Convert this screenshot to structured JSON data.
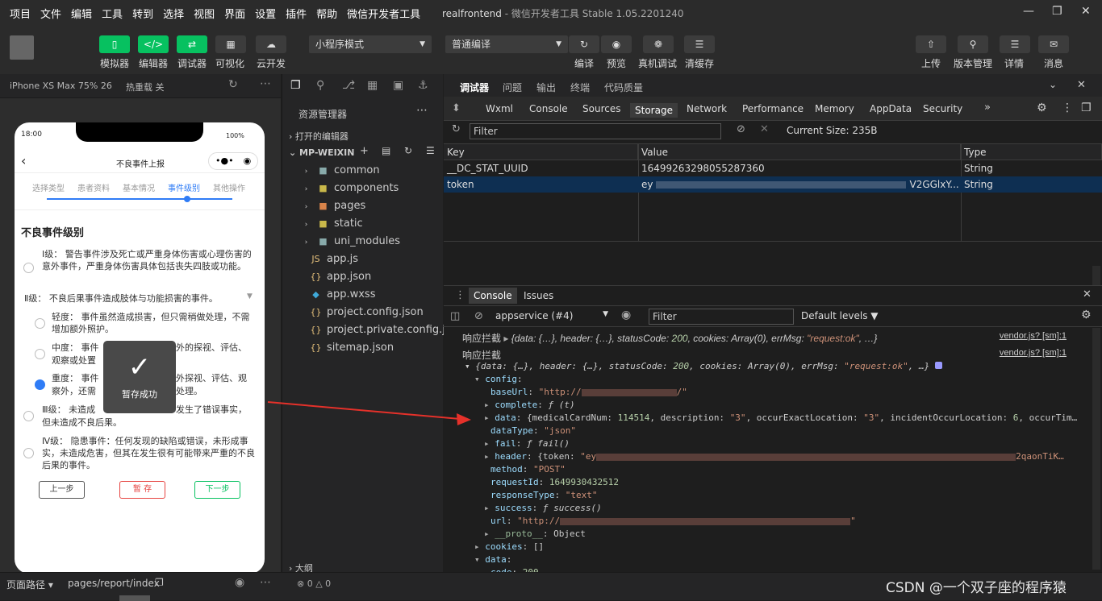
{
  "menu": [
    "项目",
    "文件",
    "编辑",
    "工具",
    "转到",
    "选择",
    "视图",
    "界面",
    "设置",
    "插件",
    "帮助",
    "微信开发者工具"
  ],
  "window_title": "realfrontend",
  "window_subtitle": "微信开发者工具 Stable 1.05.2201240",
  "toolbar": {
    "left_labels": [
      "模拟器",
      "编辑器",
      "调试器",
      "可视化",
      "云开发"
    ],
    "mode_select": "小程序模式",
    "compile_select": "普通编译",
    "mid_labels": [
      "编译",
      "预览",
      "真机调试",
      "清缓存"
    ],
    "right_labels": [
      "上传",
      "版本管理",
      "详情",
      "消息"
    ]
  },
  "sim": {
    "device": "iPhone XS Max 75% 26",
    "hotreload": "热重载 关",
    "time": "18:00",
    "battery": "100%",
    "page_title": "不良事件上报",
    "steps": [
      "选择类型",
      "患者资料",
      "基本情况",
      "事件级别",
      "其他操作"
    ],
    "active_step": 3,
    "section": "不良事件级别",
    "level1": "Ⅰ级： 警告事件涉及死亡或严重身体伤害或心理伤害的意外事件，严重身体伤害具体包括丧失四肢或功能。",
    "level2": "Ⅱ级： 不良后果事件造成肢体与功能损害的事件。",
    "light": "轻度： 事件虽然造成损害，但只需稍做处理，不需增加额外照护。",
    "medium_a": "中度： 事件",
    "medium_b": "外的探视、评估、",
    "medium_c": "观察或处置",
    "heavy_a": "重度： 事件",
    "heavy_b": "外探视、评估、观",
    "heavy_c": "察外，还需",
    "heavy_d": "处理。",
    "level3_a": "Ⅲ级： 未造成",
    "level3_b": "发生了错误事实，",
    "level3_c": "但未造成不良后果。",
    "level4": "Ⅳ级： 隐患事件：任何发现的缺陷或错误，未形成事实，未造成危害，但其在发生很有可能带来严重的不良后果的事件。",
    "btn_prev": "上一步",
    "btn_save": "暂 存",
    "btn_next": "下一步",
    "toast": "暂存成功"
  },
  "explorer": {
    "title": "资源管理器",
    "open_editors": "打开的编辑器",
    "project": "MP-WEIXIN",
    "folders": [
      "common",
      "components",
      "pages",
      "static",
      "uni_modules"
    ],
    "files": [
      "app.js",
      "app.json",
      "app.wxss",
      "project.config.json",
      "project.private.config.js...",
      "sitemap.json"
    ],
    "outline": "大纲"
  },
  "devtools": {
    "top_tabs": [
      "调试器",
      "问题",
      "输出",
      "终端",
      "代码质量"
    ],
    "panel_tabs": [
      "Wxml",
      "Console",
      "Sources",
      "Storage",
      "Network",
      "Performance",
      "Memory",
      "AppData",
      "Security"
    ],
    "filter_placeholder": "Filter",
    "current_size": "Current Size: 235B",
    "columns": [
      "Key",
      "Value",
      "Type"
    ],
    "rows": [
      {
        "key": "__DC_STAT_UUID",
        "value": "16499263298055287360",
        "type": "String"
      },
      {
        "key": "token",
        "value": "ey",
        "value_end": "V2GGlxY...",
        "type": "String"
      }
    ],
    "console_tabs": [
      "Console",
      "Issues"
    ],
    "context": "appservice (#4)",
    "levels": "Default levels",
    "source": "vendor.js? [sm]:1"
  },
  "status": {
    "path_label": "页面路径",
    "path": "pages/report/index",
    "issues": "0",
    "warnings": "0"
  },
  "watermark": "CSDN @一个双子座的程序猿"
}
